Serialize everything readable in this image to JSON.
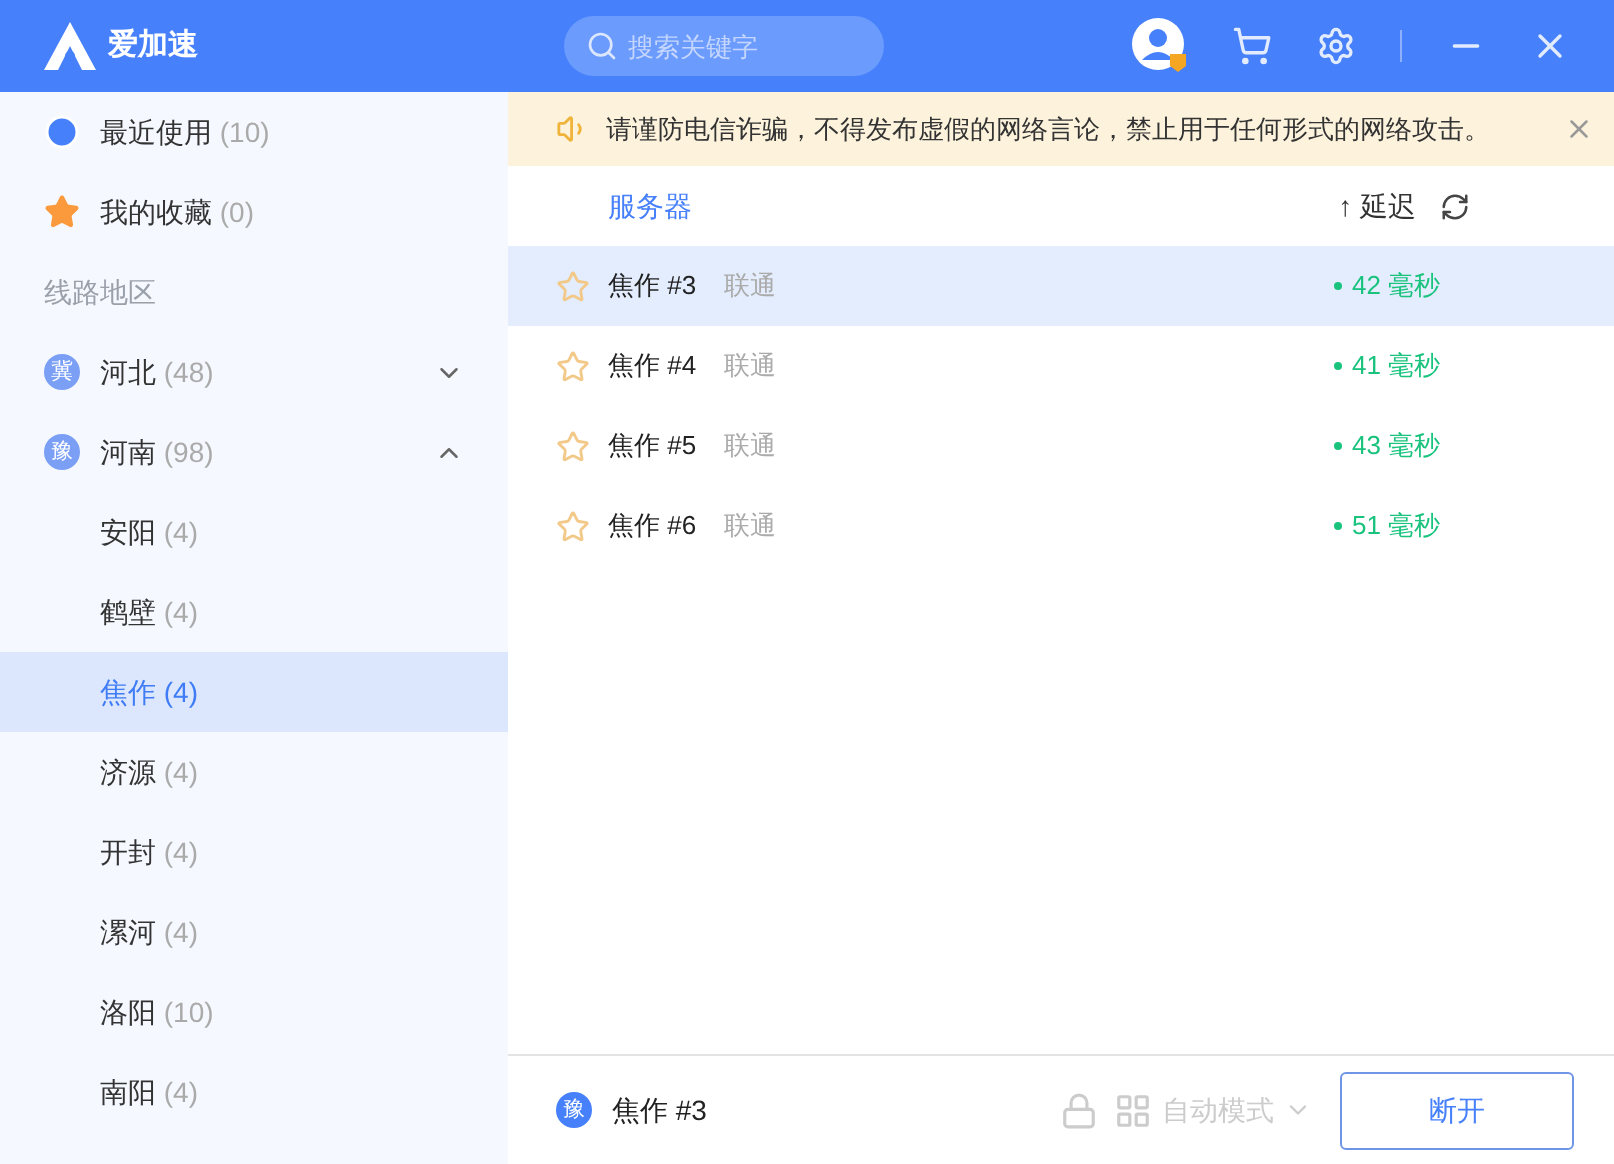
{
  "header": {
    "app_name": "爱加速",
    "search": {
      "placeholder": "搜索关键字"
    }
  },
  "sidebar": {
    "quick": [
      {
        "kind": "recent",
        "label": "最近使用",
        "count": "(10)"
      },
      {
        "kind": "favorites",
        "label": "我的收藏",
        "count": "(0)"
      }
    ],
    "section_title": "线路地区",
    "regions": [
      {
        "badge": "冀",
        "name": "河北",
        "count": "(48)",
        "expanded": false
      },
      {
        "badge": "豫",
        "name": "河南",
        "count": "(98)",
        "expanded": true,
        "children": [
          {
            "name": "安阳",
            "count": "(4)",
            "selected": false
          },
          {
            "name": "鹤壁",
            "count": "(4)",
            "selected": false
          },
          {
            "name": "焦作",
            "count": "(4)",
            "selected": true
          },
          {
            "name": "济源",
            "count": "(4)",
            "selected": false
          },
          {
            "name": "开封",
            "count": "(4)",
            "selected": false
          },
          {
            "name": "漯河",
            "count": "(4)",
            "selected": false
          },
          {
            "name": "洛阳",
            "count": "(10)",
            "selected": false
          },
          {
            "name": "南阳",
            "count": "(4)",
            "selected": false
          }
        ]
      }
    ]
  },
  "notice": "请谨防电信诈骗，不得发布虚假的网络言论，禁止用于任何形式的网络攻击。",
  "table": {
    "server_heading": "服务器",
    "latency_heading": "延迟",
    "sort_arrow": "↑",
    "rows": [
      {
        "name": "焦作 #3",
        "isp": "联通",
        "latency": "42 毫秒",
        "selected": true,
        "favorite": false
      },
      {
        "name": "焦作 #4",
        "isp": "联通",
        "latency": "41 毫秒",
        "selected": false,
        "favorite": false
      },
      {
        "name": "焦作 #5",
        "isp": "联通",
        "latency": "43 毫秒",
        "selected": false,
        "favorite": false
      },
      {
        "name": "焦作 #6",
        "isp": "联通",
        "latency": "51 毫秒",
        "selected": false,
        "favorite": false
      }
    ]
  },
  "footer": {
    "badge": "豫",
    "server": "焦作 #3",
    "mode": "自动模式",
    "button": "断开"
  }
}
